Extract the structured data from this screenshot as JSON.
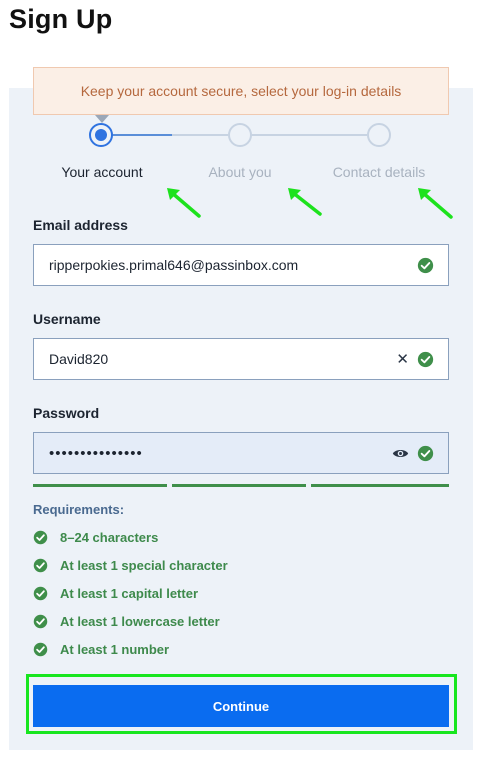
{
  "page": {
    "title": "Sign Up"
  },
  "banner": {
    "text": "Keep your account secure, select your log-in details"
  },
  "steps": [
    {
      "label": "Your account",
      "state": "current"
    },
    {
      "label": "About you",
      "state": "upcoming"
    },
    {
      "label": "Contact details",
      "state": "upcoming"
    }
  ],
  "form": {
    "email": {
      "label": "Email address",
      "value": "ripperpokies.primal646@passinbox.com",
      "status": "check-circle-icon"
    },
    "username": {
      "label": "Username",
      "value": "David820",
      "clear": "clear-icon",
      "status": "check-circle-icon"
    },
    "password": {
      "label": "Password",
      "value": "•••••••••••••••",
      "toggle": "eye-icon",
      "status": "check-circle-icon",
      "strength_segments_filled": 3,
      "strength_segments_total": 3
    }
  },
  "requirements": {
    "title": "Requirements:",
    "items": [
      "8–24 characters",
      "At least 1 special character",
      "At least 1 capital letter",
      "At least 1 lowercase letter",
      "At least 1 number"
    ]
  },
  "actions": {
    "continue_label": "Continue"
  },
  "colors": {
    "primary": "#0a6cf0",
    "success": "#3f8f4a",
    "highlight": "#17e61f",
    "banner_bg": "#fbefe6",
    "banner_text": "#b5683e",
    "panel_bg": "#edf2f8"
  }
}
